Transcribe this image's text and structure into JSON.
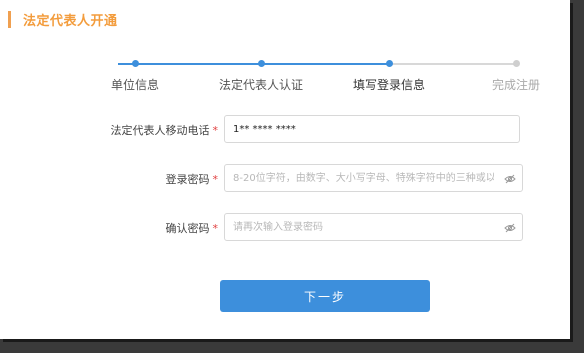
{
  "page": {
    "title": "法定代表人开通"
  },
  "colors": {
    "accent": "#f39c3c",
    "primary": "#3d8fdc",
    "step_done": "#3d8fdc",
    "step_todo": "#d0d0d0",
    "required": "#e04040"
  },
  "steps": [
    {
      "label": "单位信息",
      "state": "done"
    },
    {
      "label": "法定代表人认证",
      "state": "done"
    },
    {
      "label": "填写登录信息",
      "state": "current"
    },
    {
      "label": "完成注册",
      "state": "todo"
    }
  ],
  "form": {
    "phone": {
      "label": "法定代表人移动电话",
      "required_mark": "*",
      "value": "1** **** ****"
    },
    "password": {
      "label": "登录密码",
      "required_mark": "*",
      "placeholder": "8-20位字符，由数字、大小写字母、特殊字符中的三种或以..."
    },
    "confirm_password": {
      "label": "确认密码",
      "required_mark": "*",
      "placeholder": "请再次输入登录密码"
    }
  },
  "actions": {
    "next_label": "下一步"
  }
}
